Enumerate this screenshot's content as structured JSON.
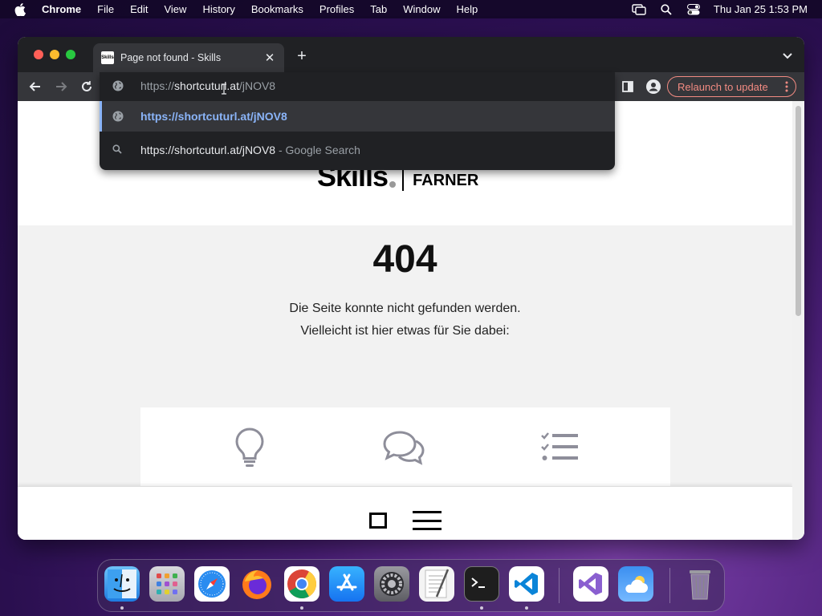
{
  "menubar": {
    "app_name": "Chrome",
    "items": [
      "File",
      "Edit",
      "View",
      "History",
      "Bookmarks",
      "Profiles",
      "Tab",
      "Window",
      "Help"
    ],
    "clock": "Thu Jan 25  1:53 PM"
  },
  "browser": {
    "tab_title": "Page not found - Skills",
    "favicon_text": "Skills",
    "address": {
      "prefix": "https://",
      "host": "shortcuturl.at",
      "path": "/jNOV8"
    },
    "suggestions": [
      {
        "icon": "globe-icon",
        "text": "https://shortcuturl.at/jNOV8",
        "sub": ""
      },
      {
        "icon": "search-icon",
        "text": "https://shortcuturl.at/jNOV8",
        "sub": " - Google Search"
      }
    ],
    "relaunch_label": "Relaunch to update"
  },
  "page": {
    "logo_word": "Skills",
    "logo_partner": "FARNER",
    "error_code": "404",
    "message_line1": "Die Seite konnte nicht gefunden werden.",
    "message_line2": "Vielleicht ist hier etwas für Sie dabei:",
    "card_icons": [
      "lightbulb-icon",
      "chat-bubbles-icon",
      "checklist-icon"
    ]
  },
  "dock": {
    "apps": [
      "Finder",
      "Launchpad",
      "Safari",
      "Firefox",
      "Chrome",
      "App Store",
      "System Settings",
      "TextEdit",
      "Terminal",
      "Visual Studio Code",
      "Visual Studio",
      "Weather",
      "Trash"
    ]
  },
  "colors": {
    "accent_link": "#8ab4f8",
    "relaunch": "#f28b82",
    "icon_gray": "#8e8e9a"
  }
}
